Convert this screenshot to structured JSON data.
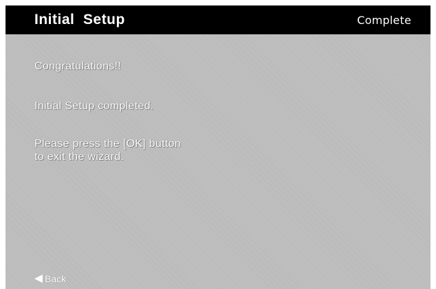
{
  "header": {
    "title": "Initial  Setup",
    "step": "Complete"
  },
  "messages": {
    "congrats": "Congratulations!!",
    "completed": "Initial Setup completed.",
    "instruction_line1": "Please press the [OK] button",
    "instruction_line2": "to exit the wizard."
  },
  "footer": {
    "back_label": "Back",
    "back_icon": "back-arrow-icon"
  },
  "colors": {
    "title_bar": "#000000",
    "background": "#b9b9b9",
    "text": "#ffffff"
  }
}
